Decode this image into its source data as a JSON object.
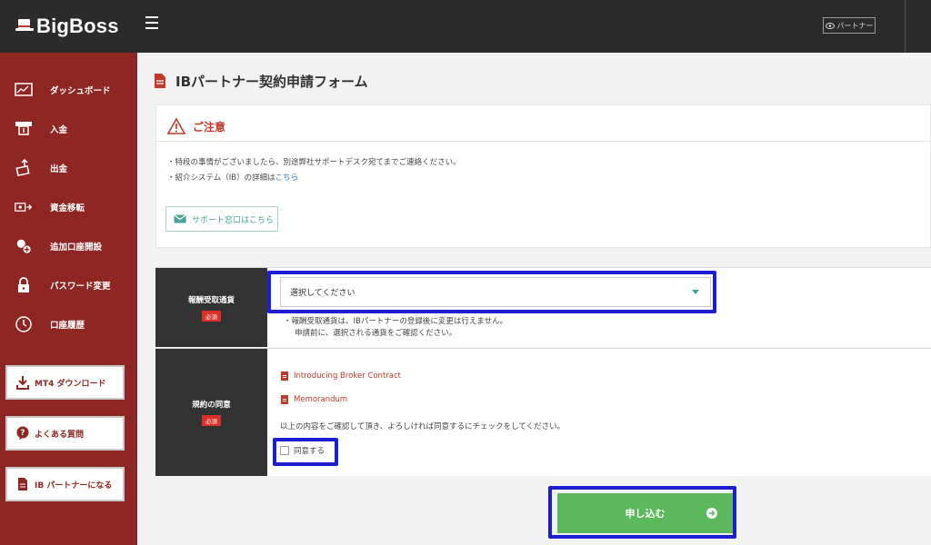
{
  "brand": {
    "logo_text": "BigBoss"
  },
  "header": {
    "menu_icon": "hamburger-icon",
    "partner_button_label": "パートナー"
  },
  "sidebar": {
    "items": [
      {
        "label": "ダッシュボード",
        "icon": "dashboard-icon"
      },
      {
        "label": "入金",
        "icon": "deposit-icon"
      },
      {
        "label": "出金",
        "icon": "withdraw-icon"
      },
      {
        "label": "資金移転",
        "icon": "transfer-icon"
      },
      {
        "label": "追加口座開設",
        "icon": "add-account-icon"
      },
      {
        "label": "パスワード変更",
        "icon": "lock-icon"
      },
      {
        "label": "口座履歴",
        "icon": "clock-icon"
      }
    ],
    "buttons": [
      {
        "label": "MT4 ダウンロード",
        "icon": "download-icon"
      },
      {
        "label": "よくある質問",
        "icon": "question-icon"
      },
      {
        "label": "IB パートナーになる",
        "icon": "document-icon"
      }
    ]
  },
  "main": {
    "page_title": "IBパートナー契約申請フォーム",
    "notice": {
      "title": "ご注意",
      "line1": "・特段の事情がございましたら、別途弊社サポートデスク宛てまでご連絡ください。",
      "line2_prefix": "・紹介システム（IB）の詳細は",
      "line2_link": "こちら",
      "support_button": "サポート窓口はこちら"
    },
    "currency_field": {
      "label": "報酬受取通貨",
      "required_badge": "必須",
      "select_value": "選択してください",
      "note1": "・報酬受取通貨は、IBパートナーの登録後に変更は行えません。",
      "note2": "申請前に、選択される通貨をご確認ください。"
    },
    "agreement_field": {
      "label": "規約の同意",
      "required_badge": "必須",
      "doc1": "Introducing Broker Contract",
      "doc2": "Memorandum",
      "instruction": "以上の内容をご確認して頂き、よろしければ同意するにチェックをしてください。",
      "checkbox_label": "同意する"
    },
    "submit_label": "申し込む"
  },
  "colors": {
    "sidebar": "#8e2623",
    "topbar": "#2b2b2b",
    "accent_red": "#c0392b",
    "submit_green": "#5cb85c",
    "highlight_blue": "#1b1fd0"
  }
}
